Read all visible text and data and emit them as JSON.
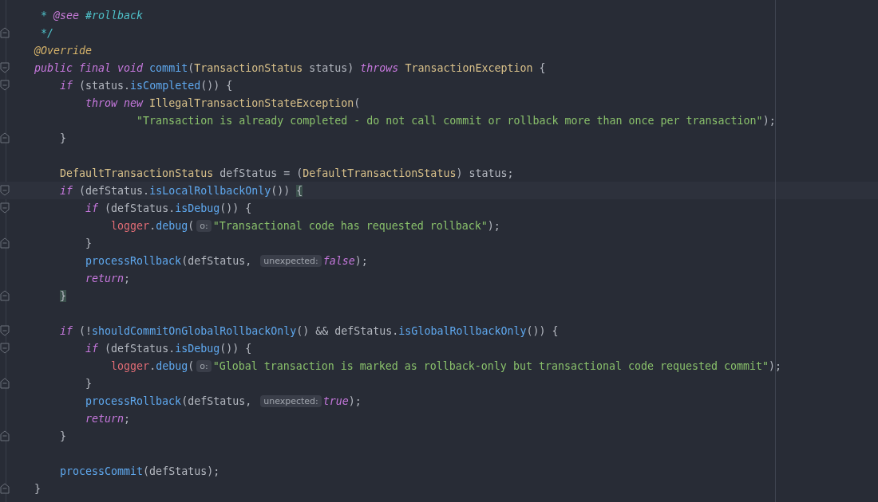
{
  "editor": {
    "lines": [
      {
        "kind": "code",
        "tokens": [
          {
            "kind": "doc",
            "text": " * "
          },
          {
            "kind": "doctag",
            "text": "@see"
          },
          {
            "kind": "doc",
            "text": " #rollback"
          }
        ]
      },
      {
        "kind": "code",
        "fold": {
          "kind": "end"
        },
        "tokens": [
          {
            "kind": "doc",
            "text": " */"
          }
        ]
      },
      {
        "kind": "code",
        "tokens": [
          {
            "kind": "ann",
            "text": "@Override"
          }
        ]
      },
      {
        "kind": "code",
        "fold": {
          "kind": "start"
        },
        "tokens": [
          {
            "kind": "kw",
            "text": "public final void "
          },
          {
            "kind": "fn",
            "text": "commit"
          },
          {
            "kind": "plain",
            "text": "("
          },
          {
            "kind": "type",
            "text": "TransactionStatus"
          },
          {
            "kind": "plain",
            "text": " status) "
          },
          {
            "kind": "kw",
            "text": "throws "
          },
          {
            "kind": "type",
            "text": "TransactionException"
          },
          {
            "kind": "plain",
            "text": " {"
          }
        ]
      },
      {
        "kind": "code",
        "fold": {
          "kind": "start"
        },
        "tokens": [
          {
            "kind": "kw",
            "text": "    if"
          },
          {
            "kind": "plain",
            "text": " (status."
          },
          {
            "kind": "fn",
            "text": "isCompleted"
          },
          {
            "kind": "plain",
            "text": "()) {"
          }
        ]
      },
      {
        "kind": "code",
        "tokens": [
          {
            "kind": "kw",
            "text": "        throw new "
          },
          {
            "kind": "type",
            "text": "IllegalTransactionStateException"
          },
          {
            "kind": "plain",
            "text": "("
          }
        ]
      },
      {
        "kind": "code",
        "tokens": [
          {
            "kind": "str",
            "text": "                \"Transaction is already completed - do not call commit or rollback more than once per transaction\""
          },
          {
            "kind": "plain",
            "text": ");"
          }
        ]
      },
      {
        "kind": "code",
        "fold": {
          "kind": "end"
        },
        "tokens": [
          {
            "kind": "plain",
            "text": "    }"
          }
        ]
      },
      {
        "kind": "blank"
      },
      {
        "kind": "code",
        "tokens": [
          {
            "kind": "type",
            "text": "    DefaultTransactionStatus"
          },
          {
            "kind": "plain",
            "text": " defStatus = ("
          },
          {
            "kind": "type",
            "text": "DefaultTransactionStatus"
          },
          {
            "kind": "plain",
            "text": ") status;"
          }
        ]
      },
      {
        "kind": "code",
        "fold": {
          "kind": "start"
        },
        "current": true,
        "tokens": [
          {
            "kind": "kw",
            "text": "    if"
          },
          {
            "kind": "plain",
            "text": " (defStatus."
          },
          {
            "kind": "fn",
            "text": "isLocalRollbackOnly"
          },
          {
            "kind": "plain",
            "text": "()) "
          },
          {
            "kind": "match",
            "text": "{"
          }
        ]
      },
      {
        "kind": "code",
        "fold": {
          "kind": "start"
        },
        "tokens": [
          {
            "kind": "kw",
            "text": "        if"
          },
          {
            "kind": "plain",
            "text": " (defStatus."
          },
          {
            "kind": "fn",
            "text": "isDebug"
          },
          {
            "kind": "plain",
            "text": "()) {"
          }
        ]
      },
      {
        "kind": "code",
        "tokens": [
          {
            "kind": "field",
            "text": "            logger"
          },
          {
            "kind": "plain",
            "text": "."
          },
          {
            "kind": "fn",
            "text": "debug"
          },
          {
            "kind": "plain",
            "text": "("
          },
          {
            "kind": "hint",
            "text": "o:"
          },
          {
            "kind": "str",
            "text": "\"Transactional code has requested rollback\""
          },
          {
            "kind": "plain",
            "text": ");"
          }
        ]
      },
      {
        "kind": "code",
        "fold": {
          "kind": "end"
        },
        "tokens": [
          {
            "kind": "plain",
            "text": "        }"
          }
        ]
      },
      {
        "kind": "code",
        "tokens": [
          {
            "kind": "fn",
            "text": "        processRollback"
          },
          {
            "kind": "plain",
            "text": "(defStatus, "
          },
          {
            "kind": "hint",
            "text": "unexpected:"
          },
          {
            "kind": "kw",
            "text": "false"
          },
          {
            "kind": "plain",
            "text": ");"
          }
        ]
      },
      {
        "kind": "code",
        "tokens": [
          {
            "kind": "kw",
            "text": "        return"
          },
          {
            "kind": "plain",
            "text": ";"
          }
        ]
      },
      {
        "kind": "code",
        "fold": {
          "kind": "end"
        },
        "tokens": [
          {
            "kind": "match",
            "text": "    }"
          }
        ]
      },
      {
        "kind": "blank"
      },
      {
        "kind": "code",
        "fold": {
          "kind": "start"
        },
        "tokens": [
          {
            "kind": "kw",
            "text": "    if"
          },
          {
            "kind": "plain",
            "text": " (!"
          },
          {
            "kind": "fn",
            "text": "shouldCommitOnGlobalRollbackOnly"
          },
          {
            "kind": "plain",
            "text": "() && defStatus."
          },
          {
            "kind": "fn",
            "text": "isGlobalRollbackOnly"
          },
          {
            "kind": "plain",
            "text": "()) {"
          }
        ]
      },
      {
        "kind": "code",
        "fold": {
          "kind": "start"
        },
        "tokens": [
          {
            "kind": "kw",
            "text": "        if"
          },
          {
            "kind": "plain",
            "text": " (defStatus."
          },
          {
            "kind": "fn",
            "text": "isDebug"
          },
          {
            "kind": "plain",
            "text": "()) {"
          }
        ]
      },
      {
        "kind": "code",
        "tokens": [
          {
            "kind": "field",
            "text": "            logger"
          },
          {
            "kind": "plain",
            "text": "."
          },
          {
            "kind": "fn",
            "text": "debug"
          },
          {
            "kind": "plain",
            "text": "("
          },
          {
            "kind": "hint",
            "text": "o:"
          },
          {
            "kind": "str",
            "text": "\"Global transaction is marked as rollback-only but transactional code requested commit\""
          },
          {
            "kind": "plain",
            "text": ");"
          }
        ]
      },
      {
        "kind": "code",
        "fold": {
          "kind": "end"
        },
        "tokens": [
          {
            "kind": "plain",
            "text": "        }"
          }
        ]
      },
      {
        "kind": "code",
        "tokens": [
          {
            "kind": "fn",
            "text": "        processRollback"
          },
          {
            "kind": "plain",
            "text": "(defStatus, "
          },
          {
            "kind": "hint",
            "text": "unexpected:"
          },
          {
            "kind": "kw",
            "text": "true"
          },
          {
            "kind": "plain",
            "text": ");"
          }
        ]
      },
      {
        "kind": "code",
        "tokens": [
          {
            "kind": "kw",
            "text": "        return"
          },
          {
            "kind": "plain",
            "text": ";"
          }
        ]
      },
      {
        "kind": "code",
        "fold": {
          "kind": "end"
        },
        "tokens": [
          {
            "kind": "plain",
            "text": "    }"
          }
        ]
      },
      {
        "kind": "blank"
      },
      {
        "kind": "code",
        "tokens": [
          {
            "kind": "fn",
            "text": "    processCommit"
          },
          {
            "kind": "plain",
            "text": "(defStatus);"
          }
        ]
      },
      {
        "kind": "code",
        "fold": {
          "kind": "end"
        },
        "tokens": [
          {
            "kind": "plain",
            "text": "}"
          }
        ]
      }
    ]
  }
}
